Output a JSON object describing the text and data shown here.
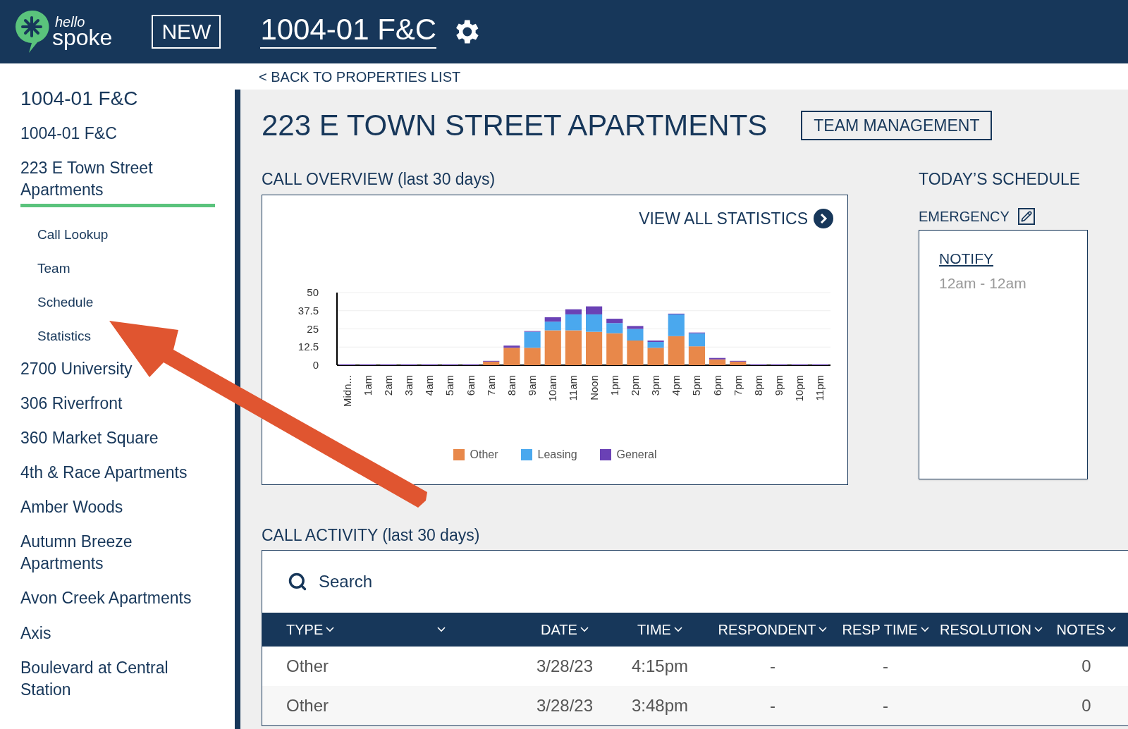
{
  "header": {
    "logo_top": "hello",
    "logo_bottom": "spoke",
    "new_button": "NEW",
    "account": "1004-01 F&C"
  },
  "back_link": "< BACK TO PROPERTIES LIST",
  "sidebar": {
    "heading": "1004-01 F&C",
    "items": [
      {
        "label": "1004-01 F&C",
        "selected": false
      },
      {
        "label": "223 E Town Street Apartments",
        "selected": true,
        "children": [
          {
            "label": "Call Lookup"
          },
          {
            "label": "Team"
          },
          {
            "label": "Schedule"
          },
          {
            "label": "Statistics"
          }
        ]
      },
      {
        "label": "2700 University",
        "selected": false
      },
      {
        "label": "306 Riverfront",
        "selected": false
      },
      {
        "label": "360 Market Square",
        "selected": false
      },
      {
        "label": "4th & Race Apartments",
        "selected": false
      },
      {
        "label": "Amber Woods",
        "selected": false
      },
      {
        "label": "Autumn Breeze Apartments",
        "selected": false
      },
      {
        "label": "Avon Creek Apartments",
        "selected": false
      },
      {
        "label": "Axis",
        "selected": false
      },
      {
        "label": "Boulevard at Central Station",
        "selected": false
      }
    ]
  },
  "page_title": "223 E TOWN STREET APARTMENTS",
  "team_button": "TEAM MANAGEMENT",
  "call_overview": {
    "title": "CALL OVERVIEW (last 30 days)",
    "link": "VIEW ALL STATISTICS",
    "chart_data": {
      "type": "bar",
      "stacked": true,
      "grid": true,
      "legend": true,
      "categories": [
        "Midn...",
        "1am",
        "2am",
        "3am",
        "4am",
        "5am",
        "6am",
        "7am",
        "8am",
        "9am",
        "10am",
        "11am",
        "Noon",
        "1pm",
        "2pm",
        "3pm",
        "4pm",
        "5pm",
        "6pm",
        "7pm",
        "8pm",
        "9pm",
        "10pm",
        "11pm"
      ],
      "ylim": [
        0,
        50
      ],
      "yticks": [
        0,
        12.5,
        25,
        37.5,
        50
      ],
      "series": [
        {
          "name": "Other",
          "color": "#e8884a",
          "values": [
            0,
            0,
            0,
            0,
            0,
            0,
            0,
            2.5,
            12,
            12,
            24,
            24,
            23,
            22,
            17,
            12,
            20,
            13,
            4,
            2.5,
            0,
            0,
            0,
            0
          ]
        },
        {
          "name": "Leasing",
          "color": "#4aa8ee",
          "values": [
            0,
            0,
            0,
            0,
            0,
            0,
            0,
            0,
            0,
            11,
            6,
            11,
            12,
            7,
            8,
            4,
            15,
            9,
            0,
            0,
            0,
            0,
            0,
            0
          ]
        },
        {
          "name": "General",
          "color": "#6a41b5",
          "values": [
            0.6,
            0.6,
            0.6,
            0.6,
            0.6,
            0.6,
            0.6,
            0.5,
            1.5,
            0.5,
            3,
            3.5,
            5.5,
            3,
            2,
            1,
            0.5,
            0.5,
            1,
            0.5,
            0.6,
            0.6,
            0.6,
            0.6
          ]
        }
      ]
    }
  },
  "schedule": {
    "title": "TODAY’S SCHEDULE",
    "group": "EMERGENCY",
    "entry_name": "NOTIFY",
    "entry_time": "12am - 12am"
  },
  "call_activity": {
    "title": "CALL ACTIVITY (last 30 days)",
    "search_placeholder": "Search",
    "columns": [
      {
        "kind": "labeled",
        "label": "TYPE"
      },
      {
        "kind": "icon-only"
      },
      {
        "kind": "labeled",
        "label": "DATE"
      },
      {
        "kind": "labeled",
        "label": "TIME"
      },
      {
        "kind": "labeled",
        "label": "RESPONDENT"
      },
      {
        "kind": "labeled",
        "label": "RESP TIME"
      },
      {
        "kind": "labeled",
        "label": "RESOLUTION"
      },
      {
        "kind": "labeled",
        "label": "NOTES"
      }
    ],
    "rows": [
      {
        "type": "Other",
        "date": "3/28/23",
        "time": "4:15pm",
        "respondent": "-",
        "resp_time": "-",
        "notes": "0"
      },
      {
        "type": "Other",
        "date": "3/28/23",
        "time": "3:48pm",
        "respondent": "-",
        "resp_time": "-",
        "notes": "0"
      }
    ]
  }
}
